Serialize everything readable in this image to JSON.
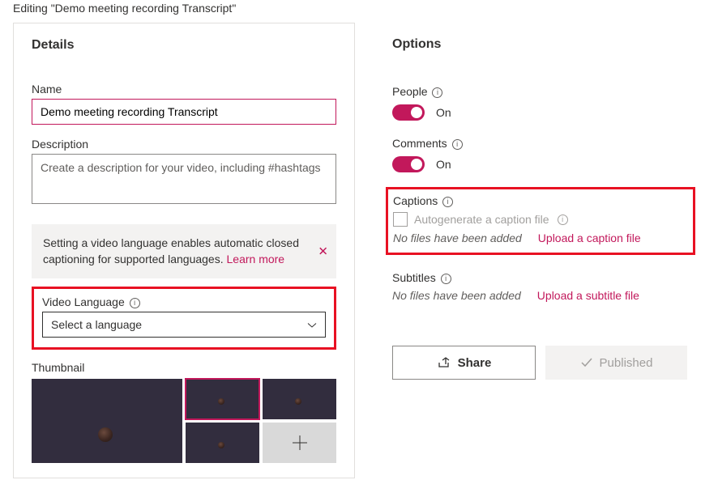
{
  "page": {
    "title": "Editing \"Demo meeting recording Transcript\""
  },
  "details": {
    "heading": "Details",
    "name_label": "Name",
    "name_value": "Demo meeting recording Transcript",
    "description_label": "Description",
    "description_placeholder": "Create a description for your video, including #hashtags",
    "banner_text": "Setting a video language enables automatic closed captioning for supported languages. ",
    "banner_link": "Learn more",
    "video_language_label": "Video Language",
    "video_language_value": "Select a language",
    "thumbnail_label": "Thumbnail"
  },
  "options": {
    "heading": "Options",
    "people_label": "People",
    "people_state": "On",
    "comments_label": "Comments",
    "comments_state": "On",
    "captions_label": "Captions",
    "captions_autogen_label": "Autogenerate a caption file",
    "captions_no_files": "No files have been added",
    "captions_upload": "Upload a caption file",
    "subtitles_label": "Subtitles",
    "subtitles_no_files": "No files have been added",
    "subtitles_upload": "Upload a subtitle file",
    "share_label": "Share",
    "published_label": "Published"
  }
}
